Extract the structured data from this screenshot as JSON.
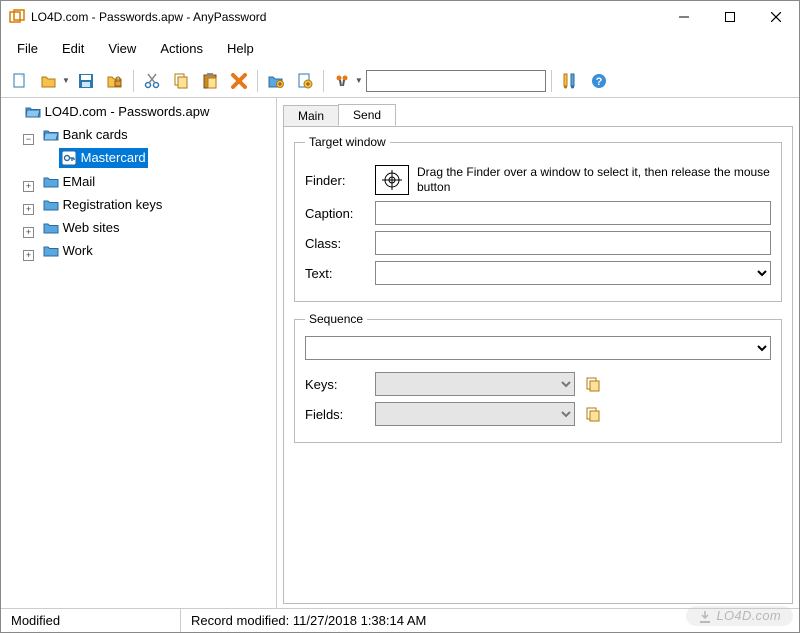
{
  "window": {
    "title": "LO4D.com - Passwords.apw - AnyPassword"
  },
  "menu": {
    "file": "File",
    "edit": "Edit",
    "view": "View",
    "actions": "Actions",
    "help": "Help"
  },
  "toolbar": {
    "search_value": ""
  },
  "tree": {
    "root": "LO4D.com - Passwords.apw",
    "items": {
      "bank_cards": "Bank cards",
      "mastercard": "Mastercard",
      "email": "EMail",
      "reg_keys": "Registration keys",
      "web_sites": "Web sites",
      "work": "Work"
    }
  },
  "tabs": {
    "main": "Main",
    "send": "Send"
  },
  "target_window": {
    "legend": "Target window",
    "finder_label": "Finder:",
    "hint": "Drag the Finder over a window to select it, then release the mouse button",
    "caption_label": "Caption:",
    "caption_value": "",
    "class_label": "Class:",
    "class_value": "",
    "text_label": "Text:",
    "text_value": ""
  },
  "sequence": {
    "legend": "Sequence",
    "value": "",
    "keys_label": "Keys:",
    "keys_value": "",
    "fields_label": "Fields:",
    "fields_value": ""
  },
  "status": {
    "modified": "Modified",
    "record_modified": "Record modified: 11/27/2018 1:38:14 AM"
  },
  "watermark": "LO4D.com"
}
